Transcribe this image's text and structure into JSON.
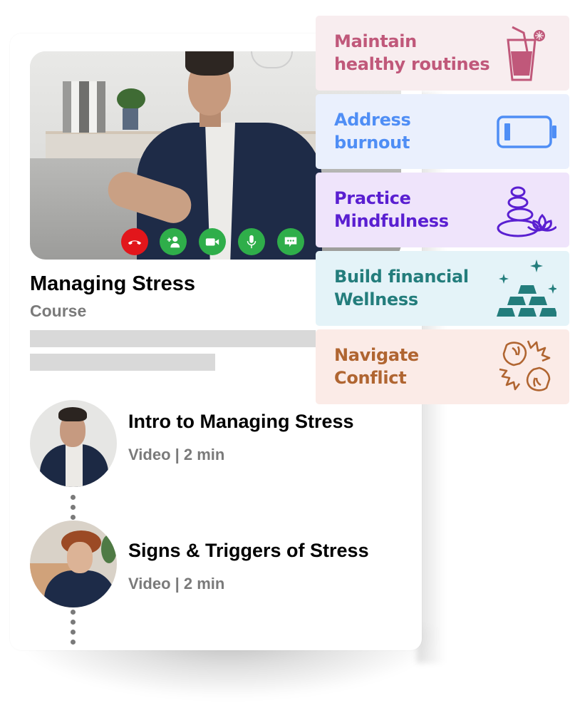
{
  "course": {
    "title": "Managing Stress",
    "type": "Course",
    "video": {
      "controls": [
        {
          "name": "end-call",
          "icon": "phone-hangup-icon",
          "color": "#e2161b"
        },
        {
          "name": "add-participant",
          "icon": "add-person-icon",
          "color": "#2fae4a"
        },
        {
          "name": "camera",
          "icon": "video-camera-icon",
          "color": "#2fae4a"
        },
        {
          "name": "microphone",
          "icon": "microphone-icon",
          "color": "#2fae4a"
        },
        {
          "name": "chat",
          "icon": "chat-bubble-icon",
          "color": "#2fae4a"
        }
      ]
    },
    "lessons": [
      {
        "title": "Intro to Managing Stress",
        "meta": "Video | 2 min"
      },
      {
        "title": "Signs & Triggers of Stress",
        "meta": "Video | 2 min"
      }
    ]
  },
  "topics": [
    {
      "label_line1": "Maintain",
      "label_line2": "healthy routines",
      "icon": "drink-glass-icon",
      "bg": "#f8edef",
      "fg": "#c0587a"
    },
    {
      "label_line1": "Address",
      "label_line2": "burnout",
      "icon": "low-battery-icon",
      "bg": "#eaf0fd",
      "fg": "#4f8ef5"
    },
    {
      "label_line1": "Practice",
      "label_line2": "Mindfulness",
      "icon": "stacked-stones-lotus-icon",
      "bg": "#efe4fb",
      "fg": "#5a1fd1"
    },
    {
      "label_line1": "Build financial",
      "label_line2": "Wellness",
      "icon": "gold-bars-icon",
      "bg": "#e4f3f8",
      "fg": "#237d7c"
    },
    {
      "label_line1": "Navigate",
      "label_line2": "Conflict",
      "icon": "clashing-fists-icon",
      "bg": "#fbebe7",
      "fg": "#b06531"
    }
  ]
}
